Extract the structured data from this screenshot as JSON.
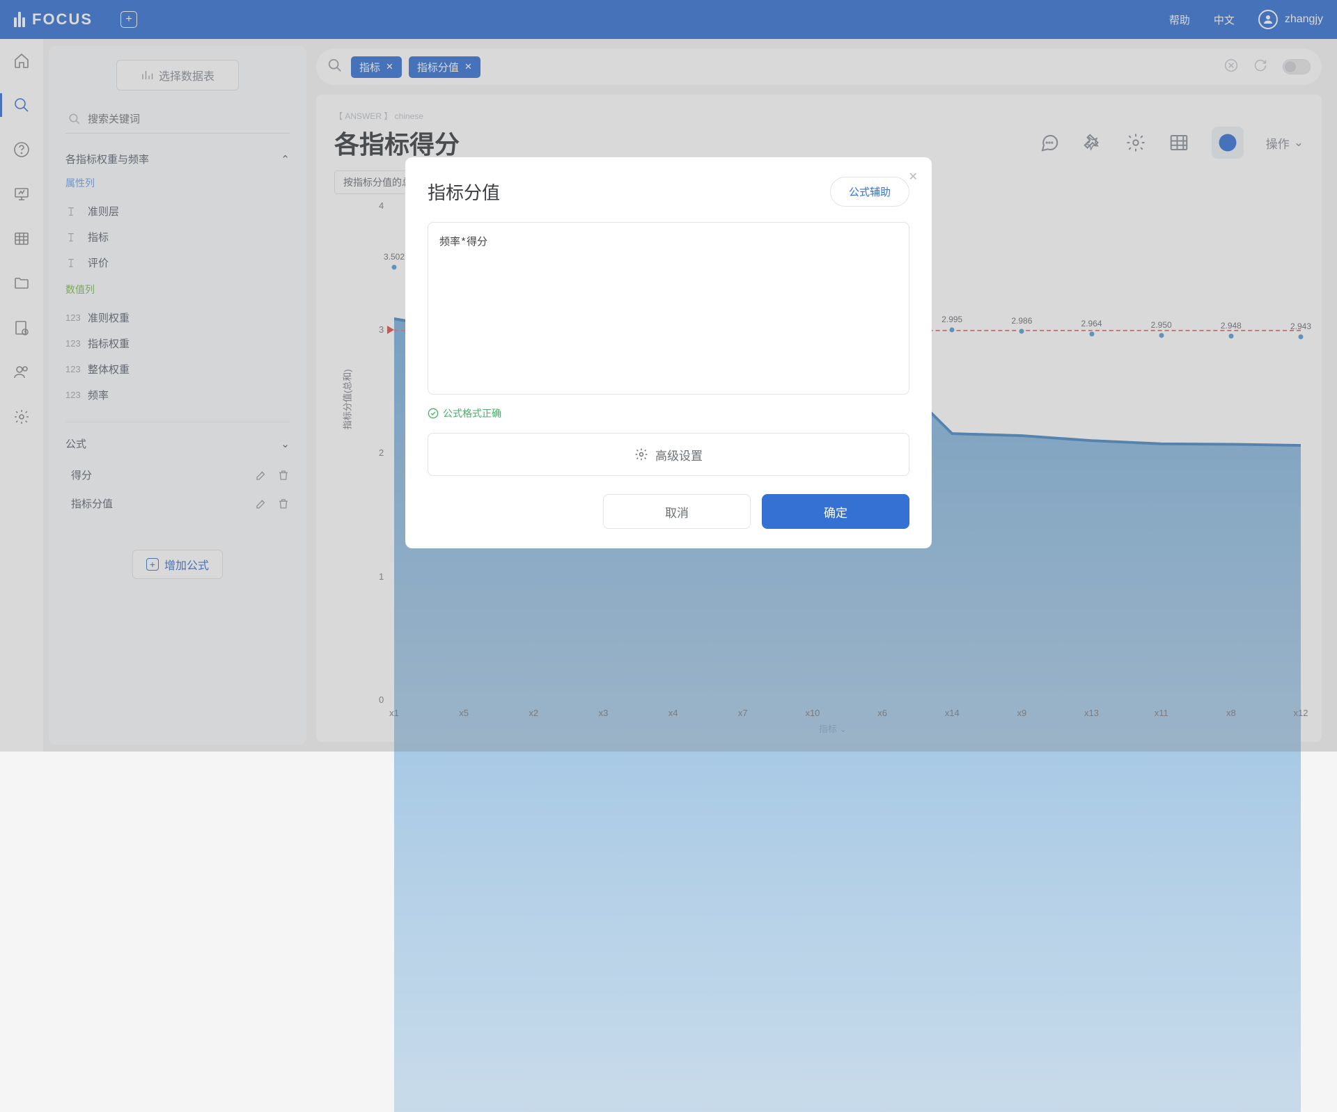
{
  "brand": "FOCUS",
  "header": {
    "help": "帮助",
    "lang": "中文",
    "user": "zhangjy"
  },
  "sidebar": {
    "select_table": "选择数据表",
    "search_placeholder": "搜索关键词",
    "group": "各指标权重与频率",
    "attr_label": "属性列",
    "num_label": "数值列",
    "attr_fields": [
      "准则层",
      "指标",
      "评价"
    ],
    "num_fields": [
      "准则权重",
      "指标权重",
      "整体权重",
      "频率"
    ],
    "formula_label": "公式",
    "formulas": [
      "得分",
      "指标分值"
    ],
    "add_formula": "增加公式"
  },
  "query": {
    "chips": [
      "指标",
      "指标分值"
    ]
  },
  "card": {
    "crumb": "【 ANSWER 】 chinese",
    "title": "各指标得分",
    "operation": "操作",
    "filter": "按指标分值的总和降序排列的指标"
  },
  "modal": {
    "title": "指标分值",
    "help": "公式辅助",
    "formula": "频率*得分",
    "valid": "公式格式正确",
    "advanced": "高级设置",
    "cancel": "取消",
    "ok": "确定"
  },
  "chart_data": {
    "type": "area",
    "xlabel": "指标",
    "ylabel": "指标分值(总和)",
    "ylim": [
      0,
      4
    ],
    "yticks": [
      0,
      1,
      2,
      3,
      4
    ],
    "reference": 3,
    "categories": [
      "x1",
      "x5",
      "x2",
      "x3",
      "x4",
      "x7",
      "x10",
      "x6",
      "x14",
      "x9",
      "x13",
      "x11",
      "x8",
      "x12"
    ],
    "values": [
      3.502,
      3.45,
      3.42,
      3.4,
      3.38,
      3.35,
      3.32,
      3.3,
      2.995,
      2.986,
      2.964,
      2.95,
      2.948,
      2.943
    ],
    "labels": [
      "3.502",
      "",
      "",
      "",
      "",
      "",
      "",
      "",
      "2.995",
      "2.986",
      "2.964",
      "2.950",
      "2.948",
      "2.943"
    ]
  }
}
